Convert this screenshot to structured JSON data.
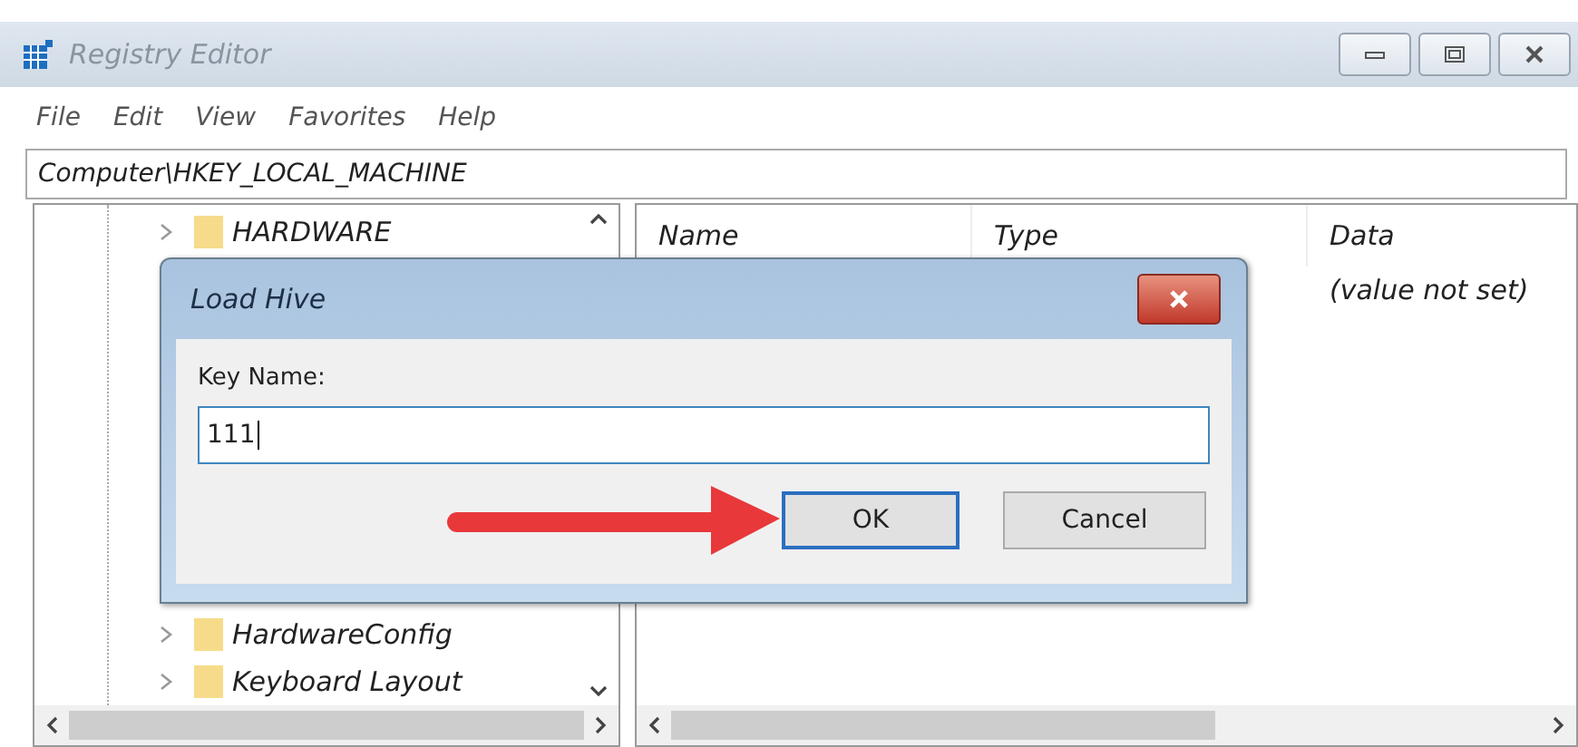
{
  "window": {
    "title": "Registry Editor"
  },
  "menu": [
    "File",
    "Edit",
    "View",
    "Favorites",
    "Help"
  ],
  "address": "Computer\\HKEY_LOCAL_MACHINE",
  "tree": {
    "items": [
      {
        "label": "HARDWARE"
      },
      {
        "label": "HardwareConfig"
      },
      {
        "label": "Keyboard Layout"
      }
    ]
  },
  "list": {
    "columns": [
      "Name",
      "Type",
      "Data"
    ],
    "rows": [
      {
        "data": "(value not set)"
      }
    ]
  },
  "dialog": {
    "title": "Load Hive",
    "label": "Key Name:",
    "value": "111",
    "buttons": [
      {
        "label": "OK",
        "selected": true
      },
      {
        "label": "Cancel",
        "selected": false
      }
    ]
  }
}
